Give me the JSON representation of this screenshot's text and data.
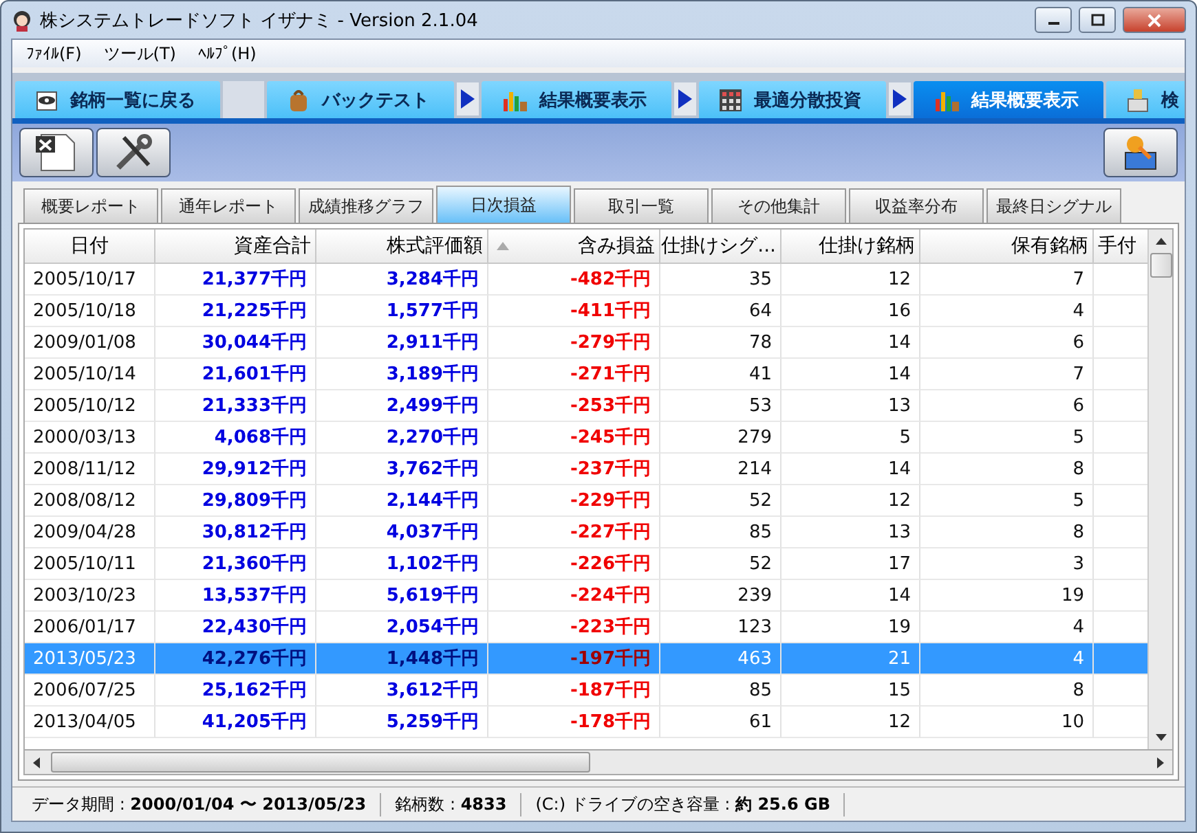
{
  "window": {
    "title": "株システムトレードソフト イザナミ - Version 2.1.04"
  },
  "menu": [
    "ﾌｧｲﾙ(F)",
    "ツール(T)",
    "ﾍﾙﾌﾟ(H)"
  ],
  "nav_tabs": [
    {
      "label": "銘柄一覧に戻る",
      "kind": "eye",
      "selected": false,
      "arrow_before": false
    },
    {
      "label": "バックテスト",
      "kind": "bag",
      "selected": false,
      "arrow_before": false
    },
    {
      "label": "結果概要表示",
      "kind": "chart",
      "selected": false,
      "arrow_before": true
    },
    {
      "label": "最適分散投資",
      "kind": "grid",
      "selected": false,
      "arrow_before": true
    },
    {
      "label": "結果概要表示",
      "kind": "chart",
      "selected": true,
      "arrow_before": true
    },
    {
      "label": "検",
      "kind": "box",
      "selected": false,
      "arrow_before": false
    }
  ],
  "report_tabs": [
    {
      "label": "概要レポート",
      "selected": false
    },
    {
      "label": "通年レポート",
      "selected": false
    },
    {
      "label": "成績推移グラフ",
      "selected": false
    },
    {
      "label": "日次損益",
      "selected": true
    },
    {
      "label": "取引一覧",
      "selected": false
    },
    {
      "label": "その他集計",
      "selected": false
    },
    {
      "label": "収益率分布",
      "selected": false
    },
    {
      "label": "最終日シグナル",
      "selected": false
    }
  ],
  "table": {
    "columns": [
      {
        "label": "日付",
        "sorted": false
      },
      {
        "label": "資産合計",
        "sorted": false
      },
      {
        "label": "株式評価額",
        "sorted": false
      },
      {
        "label": "含み損益",
        "sorted": true
      },
      {
        "label": "仕掛けシグ...",
        "sorted": false
      },
      {
        "label": "仕掛け銘柄",
        "sorted": false
      },
      {
        "label": "保有銘柄",
        "sorted": false
      },
      {
        "label": "手付",
        "sorted": false
      }
    ],
    "rows": [
      {
        "cells": [
          "2005/10/17",
          "21,377千円",
          "3,284千円",
          "-482千円",
          "35",
          "12",
          "7"
        ],
        "selected": false
      },
      {
        "cells": [
          "2005/10/18",
          "21,225千円",
          "1,577千円",
          "-411千円",
          "64",
          "16",
          "4"
        ],
        "selected": false
      },
      {
        "cells": [
          "2009/01/08",
          "30,044千円",
          "2,911千円",
          "-279千円",
          "78",
          "14",
          "6"
        ],
        "selected": false
      },
      {
        "cells": [
          "2005/10/14",
          "21,601千円",
          "3,189千円",
          "-271千円",
          "41",
          "14",
          "7"
        ],
        "selected": false
      },
      {
        "cells": [
          "2005/10/12",
          "21,333千円",
          "2,499千円",
          "-253千円",
          "53",
          "13",
          "6"
        ],
        "selected": false
      },
      {
        "cells": [
          "2000/03/13",
          "4,068千円",
          "2,270千円",
          "-245千円",
          "279",
          "5",
          "5"
        ],
        "selected": false
      },
      {
        "cells": [
          "2008/11/12",
          "29,912千円",
          "3,762千円",
          "-237千円",
          "214",
          "14",
          "8"
        ],
        "selected": false
      },
      {
        "cells": [
          "2008/08/12",
          "29,809千円",
          "2,144千円",
          "-229千円",
          "52",
          "12",
          "5"
        ],
        "selected": false
      },
      {
        "cells": [
          "2009/04/28",
          "30,812千円",
          "4,037千円",
          "-227千円",
          "85",
          "13",
          "8"
        ],
        "selected": false
      },
      {
        "cells": [
          "2005/10/11",
          "21,360千円",
          "1,102千円",
          "-226千円",
          "52",
          "17",
          "3"
        ],
        "selected": false
      },
      {
        "cells": [
          "2003/10/23",
          "13,537千円",
          "5,619千円",
          "-224千円",
          "239",
          "14",
          "19"
        ],
        "selected": false
      },
      {
        "cells": [
          "2006/01/17",
          "22,430千円",
          "2,054千円",
          "-223千円",
          "123",
          "19",
          "4"
        ],
        "selected": false
      },
      {
        "cells": [
          "2013/05/23",
          "42,276千円",
          "1,448千円",
          "-197千円",
          "463",
          "21",
          "4"
        ],
        "selected": true
      },
      {
        "cells": [
          "2006/07/25",
          "25,162千円",
          "3,612千円",
          "-187千円",
          "85",
          "15",
          "8"
        ],
        "selected": false
      },
      {
        "cells": [
          "2013/04/05",
          "41,205千円",
          "5,259千円",
          "-178千円",
          "61",
          "12",
          "10"
        ],
        "selected": false
      }
    ]
  },
  "status_bar": [
    "データ期間 : **2000/01/04 〜 2013/05/23**",
    "銘柄数 : **4833**",
    "(C:) ドライブの空き容量 : **約 25.6 GB**"
  ]
}
